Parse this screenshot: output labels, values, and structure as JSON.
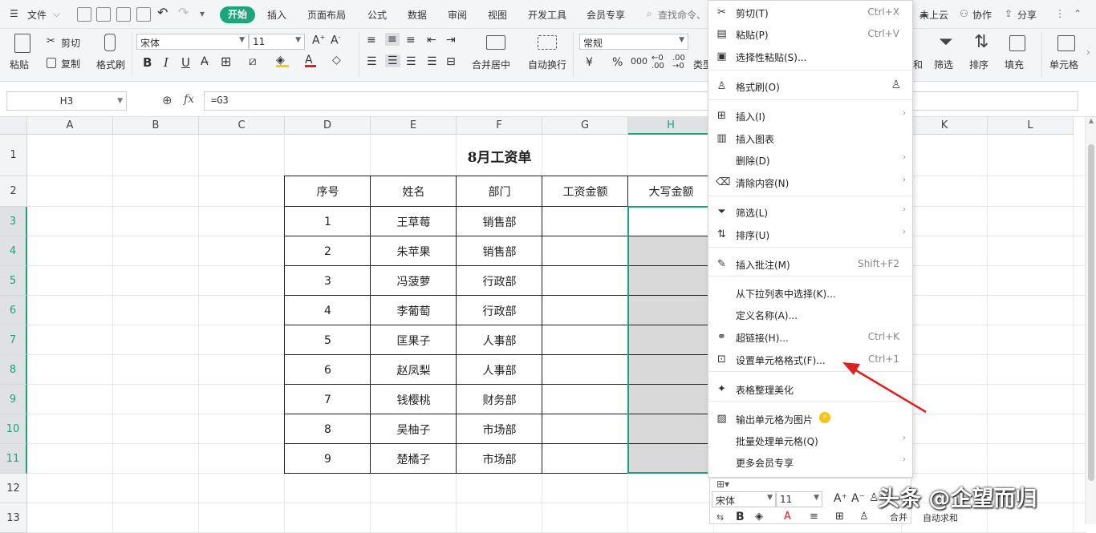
{
  "menubar": {
    "file": "文件",
    "tabs": [
      "开始",
      "插入",
      "页面布局",
      "公式",
      "数据",
      "审阅",
      "视图",
      "开发工具",
      "会员专享"
    ],
    "active_tab": "开始",
    "search": "查找命令、",
    "right": [
      "未上云",
      "协作",
      "分享"
    ]
  },
  "ribbon": {
    "paste": "粘贴",
    "cut": "剪切",
    "copy": "复制",
    "format_painter": "格式刷",
    "font_name": "宋体",
    "font_size": "11",
    "merge_center": "合并居中",
    "wrap": "自动换行",
    "number_format": "常规",
    "currency": "¥",
    "percent": "%",
    "thousands": "000",
    "style_partial": "类型",
    "right_partial": "和",
    "filter": "筛选",
    "sort": "排序",
    "fill": "填充",
    "cell": "单元格"
  },
  "formula_bar": {
    "name_box": "H3",
    "fx": "fx",
    "formula": "=G3"
  },
  "columns": [
    "A",
    "B",
    "C",
    "D",
    "E",
    "F",
    "G",
    "H",
    "K",
    "L"
  ],
  "rows": [
    "1",
    "2",
    "3",
    "4",
    "5",
    "6",
    "7",
    "8",
    "9",
    "10",
    "11",
    "12",
    "13"
  ],
  "sheet": {
    "title": "8月工资单",
    "headers": [
      "序号",
      "姓名",
      "部门",
      "工资金额",
      "大写金额"
    ],
    "records": [
      [
        "1",
        "王草莓",
        "销售部"
      ],
      [
        "2",
        "朱苹果",
        "销售部"
      ],
      [
        "3",
        "冯菠萝",
        "行政部"
      ],
      [
        "4",
        "李葡萄",
        "行政部"
      ],
      [
        "5",
        "匡果子",
        "人事部"
      ],
      [
        "6",
        "赵凤梨",
        "人事部"
      ],
      [
        "7",
        "钱樱桃",
        "财务部"
      ],
      [
        "8",
        "吴柚子",
        "市场部"
      ],
      [
        "9",
        "楚橘子",
        "市场部"
      ]
    ]
  },
  "context_menu": [
    {
      "label": "剪切(T)",
      "shortcut": "Ctrl+X",
      "icon": "scissors-icon"
    },
    {
      "label": "粘贴(P)",
      "shortcut": "Ctrl+V",
      "icon": "paste-icon"
    },
    {
      "label": "选择性粘贴(S)...",
      "shortcut": "",
      "icon": "paste-special-icon"
    },
    {
      "label": "格式刷(O)",
      "shortcut": "",
      "icon": "format-painter-icon"
    },
    {
      "label": "插入(I)",
      "shortcut": "",
      "icon": "insert-icon",
      "sub": true
    },
    {
      "label": "插入图表",
      "shortcut": "",
      "icon": "chart-icon"
    },
    {
      "label": "删除(D)",
      "shortcut": "",
      "icon": "",
      "sub": true
    },
    {
      "label": "清除内容(N)",
      "shortcut": "",
      "icon": "eraser-icon",
      "sub": true
    },
    {
      "label": "筛选(L)",
      "shortcut": "",
      "icon": "filter-icon",
      "sub": true
    },
    {
      "label": "排序(U)",
      "shortcut": "",
      "icon": "sort-icon",
      "sub": true
    },
    {
      "label": "插入批注(M)",
      "shortcut": "Shift+F2",
      "icon": "comment-icon"
    },
    {
      "label": "从下拉列表中选择(K)...",
      "shortcut": "",
      "icon": ""
    },
    {
      "label": "定义名称(A)...",
      "shortcut": "",
      "icon": ""
    },
    {
      "label": "超链接(H)...",
      "shortcut": "Ctrl+K",
      "icon": "link-icon"
    },
    {
      "label": "设置单元格格式(F)...",
      "shortcut": "Ctrl+1",
      "icon": "format-cells-icon"
    },
    {
      "label": "表格整理美化",
      "shortcut": "",
      "icon": "beautify-icon"
    },
    {
      "label": "输出单元格为图片",
      "shortcut": "",
      "icon": "image-icon"
    },
    {
      "label": "批量处理单元格(Q)",
      "shortcut": "",
      "icon": "",
      "sub": true
    },
    {
      "label": "更多会员专享",
      "shortcut": "",
      "icon": "",
      "sub": true
    }
  ],
  "mini_toolbar": {
    "font": "宋体",
    "size": "11",
    "merge": "合并",
    "autosum": "自动求和"
  },
  "watermark": "头条 @企望而归",
  "colors": {
    "accent": "#1aa57a",
    "selection_fill": "#d9d9d9",
    "arrow": "#e02020"
  }
}
